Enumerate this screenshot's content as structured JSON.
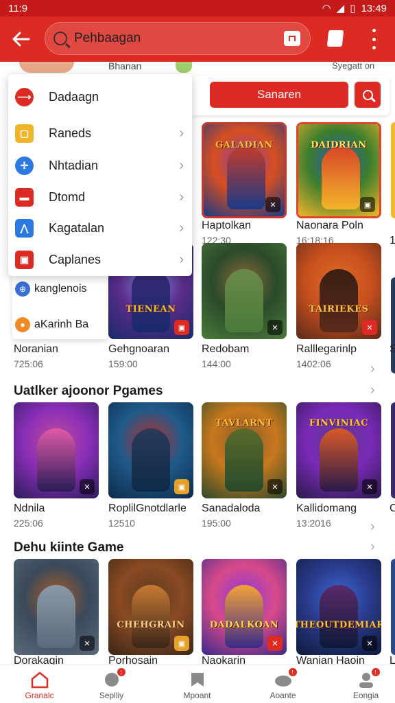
{
  "status_bar": {
    "time": "11:9",
    "clock": "13:49"
  },
  "app_bar": {
    "search_value": "Pehbaagan",
    "colors": {
      "primary": "#dc2b23"
    }
  },
  "background_header": {
    "title": "Bhanan",
    "link": "Syegatt on"
  },
  "filter": {
    "search_button": "Sanaren"
  },
  "dropdown": {
    "items": [
      {
        "label": "Dadaagn",
        "icon": "brand-icon",
        "color": "#dc2b23",
        "chevron": false
      },
      {
        "label": "Raneds",
        "icon": "square-icon",
        "color": "#f0b429",
        "chevron": true
      },
      {
        "label": "Nhtadian",
        "icon": "globe-icon",
        "color": "#2a7ae2",
        "chevron": true
      },
      {
        "label": "Dtomd",
        "icon": "box-icon",
        "color": "#dc2b23",
        "chevron": true
      },
      {
        "label": "Kagatalan",
        "icon": "runner-icon",
        "color": "#2a7ae2",
        "chevron": true
      },
      {
        "label": "Caplanes",
        "icon": "image-icon",
        "color": "#dc2b23",
        "chevron": true
      }
    ],
    "partial": [
      {
        "label": "kanglenois",
        "icon": "account-icon"
      },
      {
        "label": "aKarinh Ba",
        "icon": "colorful-app-icon"
      }
    ]
  },
  "rows": [
    {
      "section": "",
      "tiles": [
        {
          "title": "Haptolkan",
          "sub": "122:30",
          "logo": "GALADIAN",
          "theme": "warrior"
        },
        {
          "title": "Naonara Poln",
          "sub": "16:18:16",
          "logo": "DAIDRIAN",
          "theme": "heroes"
        }
      ]
    },
    {
      "section": "",
      "tiles": [
        {
          "title": "Noranian",
          "sub": "725:06",
          "logo": "",
          "theme": "sunset"
        },
        {
          "title": "Gehgnoaran",
          "sub": "159:00",
          "logo": "TIENEAN",
          "theme": "dark-knight"
        },
        {
          "title": "Redobam",
          "sub": "144:00",
          "logo": "",
          "theme": "forest"
        },
        {
          "title": "Ralllegarinlp",
          "sub": "1402:06",
          "logo": "TAIRIEKES",
          "theme": "fire"
        }
      ]
    },
    {
      "section": "Uatlker ajoonor Pgames",
      "tiles": [
        {
          "title": "Ndnila",
          "sub": "225:06",
          "logo": "",
          "theme": "purple"
        },
        {
          "title": "RoplilGnotdlarle",
          "sub": "12510",
          "logo": "",
          "theme": "blue"
        },
        {
          "title": "Sanadaloda",
          "sub": "195:00",
          "logo": "TAVLARNT",
          "theme": "orange"
        },
        {
          "title": "Kallidomang",
          "sub": "13:2016",
          "logo": "FINVINIAC",
          "theme": "violet"
        }
      ]
    },
    {
      "section": "Dehu kiinte Game",
      "tiles": [
        {
          "title": "Dorakagin",
          "sub": "",
          "logo": "",
          "theme": "city"
        },
        {
          "title": "Porhosain",
          "sub": "",
          "logo": "CHEHGRAIN",
          "theme": "steampunk"
        },
        {
          "title": "Naokarin",
          "sub": "",
          "logo": "DADALKOAN",
          "theme": "festival"
        },
        {
          "title": "Wanian Haoin",
          "sub": "",
          "logo": "THEOUTDEMIAR",
          "theme": "night"
        }
      ]
    }
  ],
  "edge": {
    "row1_sub": "1",
    "row2_text": "S",
    "row3_text": "C",
    "row4_text": "L"
  },
  "bottom_nav": [
    {
      "label": "Granalc",
      "icon": "home-icon",
      "badge": false,
      "active": true
    },
    {
      "label": "Seplliy",
      "icon": "tag-icon",
      "badge": true
    },
    {
      "label": "Mpoant",
      "icon": "bookmark-icon",
      "badge": false
    },
    {
      "label": "Aoante",
      "icon": "cloud-icon",
      "badge": true
    },
    {
      "label": "Eongia",
      "icon": "profile-icon",
      "badge": true
    }
  ]
}
